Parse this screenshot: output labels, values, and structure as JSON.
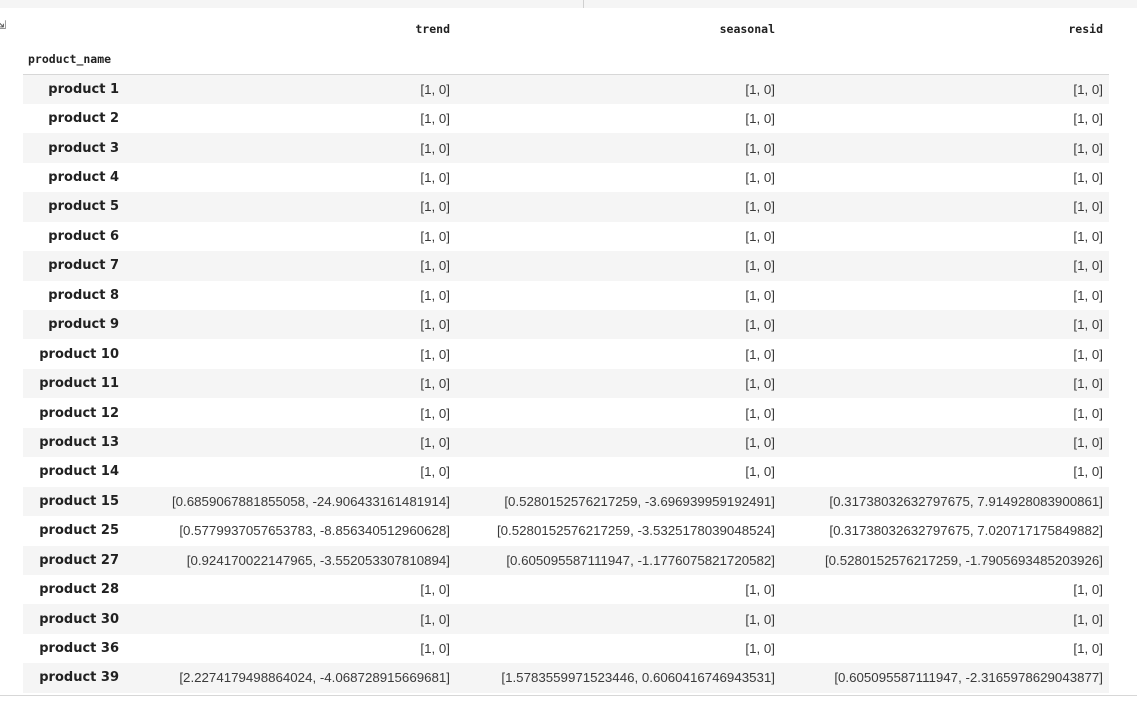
{
  "output_icon": "output-arrow-icon",
  "table": {
    "index_name": "product_name",
    "columns": [
      "trend",
      "seasonal",
      "resid"
    ],
    "rows": [
      {
        "name": "product 1",
        "trend": "[1, 0]",
        "seasonal": "[1, 0]",
        "resid": "[1, 0]"
      },
      {
        "name": "product 2",
        "trend": "[1, 0]",
        "seasonal": "[1, 0]",
        "resid": "[1, 0]"
      },
      {
        "name": "product 3",
        "trend": "[1, 0]",
        "seasonal": "[1, 0]",
        "resid": "[1, 0]"
      },
      {
        "name": "product 4",
        "trend": "[1, 0]",
        "seasonal": "[1, 0]",
        "resid": "[1, 0]"
      },
      {
        "name": "product 5",
        "trend": "[1, 0]",
        "seasonal": "[1, 0]",
        "resid": "[1, 0]"
      },
      {
        "name": "product 6",
        "trend": "[1, 0]",
        "seasonal": "[1, 0]",
        "resid": "[1, 0]"
      },
      {
        "name": "product 7",
        "trend": "[1, 0]",
        "seasonal": "[1, 0]",
        "resid": "[1, 0]"
      },
      {
        "name": "product 8",
        "trend": "[1, 0]",
        "seasonal": "[1, 0]",
        "resid": "[1, 0]"
      },
      {
        "name": "product 9",
        "trend": "[1, 0]",
        "seasonal": "[1, 0]",
        "resid": "[1, 0]"
      },
      {
        "name": "product 10",
        "trend": "[1, 0]",
        "seasonal": "[1, 0]",
        "resid": "[1, 0]"
      },
      {
        "name": "product 11",
        "trend": "[1, 0]",
        "seasonal": "[1, 0]",
        "resid": "[1, 0]"
      },
      {
        "name": "product 12",
        "trend": "[1, 0]",
        "seasonal": "[1, 0]",
        "resid": "[1, 0]"
      },
      {
        "name": "product 13",
        "trend": "[1, 0]",
        "seasonal": "[1, 0]",
        "resid": "[1, 0]"
      },
      {
        "name": "product 14",
        "trend": "[1, 0]",
        "seasonal": "[1, 0]",
        "resid": "[1, 0]"
      },
      {
        "name": "product 15",
        "trend": "[0.6859067881855058, -24.906433161481914]",
        "seasonal": "[0.5280152576217259, -3.696939959192491]",
        "resid": "[0.31738032632797675, 7.914928083900861]"
      },
      {
        "name": "product 25",
        "trend": "[0.5779937057653783, -8.856340512960628]",
        "seasonal": "[0.5280152576217259, -3.5325178039048524]",
        "resid": "[0.31738032632797675, 7.020717175849882]"
      },
      {
        "name": "product 27",
        "trend": "[0.924170022147965, -3.552053307810894]",
        "seasonal": "[0.605095587111947, -1.1776075821720582]",
        "resid": "[0.5280152576217259, -1.7905693485203926]"
      },
      {
        "name": "product 28",
        "trend": "[1, 0]",
        "seasonal": "[1, 0]",
        "resid": "[1, 0]"
      },
      {
        "name": "product 30",
        "trend": "[1, 0]",
        "seasonal": "[1, 0]",
        "resid": "[1, 0]"
      },
      {
        "name": "product 36",
        "trend": "[1, 0]",
        "seasonal": "[1, 0]",
        "resid": "[1, 0]"
      },
      {
        "name": "product 39",
        "trend": "[2.2274179498864024, -4.068728915669681]",
        "seasonal": "[1.5783559971523446, 0.6060416746943531]",
        "resid": "[0.605095587111947, -2.3165978629043877]"
      }
    ]
  }
}
